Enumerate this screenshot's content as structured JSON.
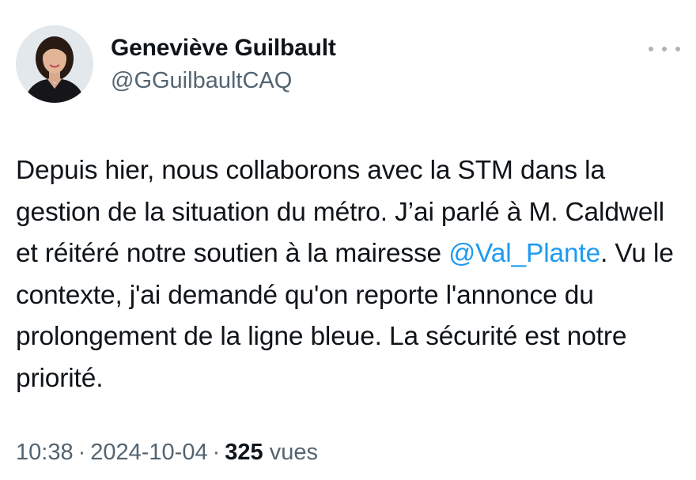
{
  "author": {
    "display_name": "Geneviève Guilbault",
    "handle": "@GGuilbaultCAQ"
  },
  "tweet": {
    "text_before_mention": "Depuis hier, nous collaborons avec la STM dans la gestion de la situation du métro. J’ai parlé à M. Caldwell et réitéré notre soutien à la mairesse ",
    "mention": "@Val_Plante",
    "text_after_mention": ". Vu le contexte, j'ai demandé qu'on reporte l'annonce du prolongement de la ligne bleue. La sécurité est notre priorité."
  },
  "meta": {
    "time": "10:38",
    "separator": "·",
    "date": "2024-10-04",
    "views_count": "325",
    "views_label": "vues"
  },
  "colors": {
    "link": "#1d9bf0",
    "secondary_text": "#536471",
    "primary_text": "#0f1419"
  },
  "icons": {
    "more": "more-horizontal-icon"
  }
}
